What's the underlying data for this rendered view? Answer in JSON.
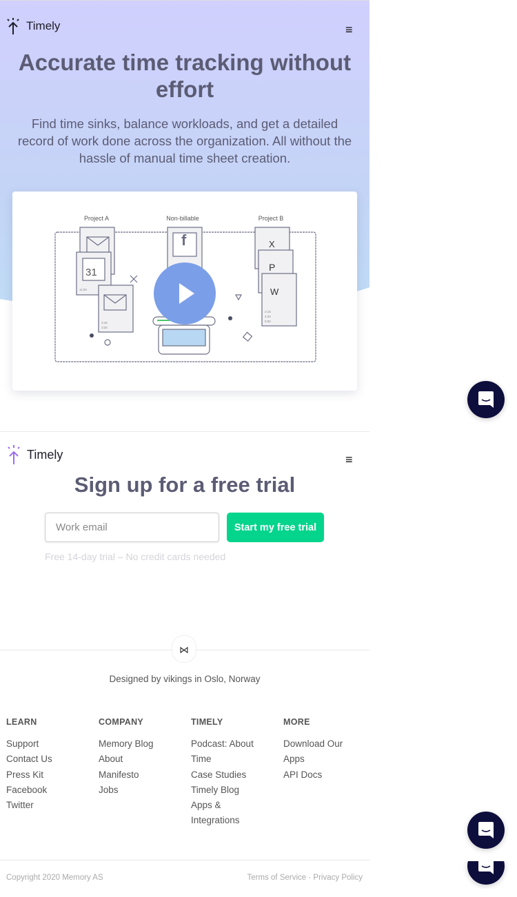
{
  "brand": "Timely",
  "hero": {
    "title": "Accurate time tracking without effort",
    "subtitle": "Find time sinks, balance workloads, and get a detailed record of work done across the organization. All without the hassle of manual time sheet creation.",
    "illustration": {
      "labels": [
        "Project A",
        "Non-billable",
        "Project B"
      ],
      "calendar_day": "31",
      "times": [
        "11:00",
        "2:45",
        "3:20",
        "2:15",
        "4:20",
        "5:00"
      ]
    }
  },
  "signup": {
    "title": "Sign up for a free trial",
    "email_placeholder": "Work email",
    "button": "Start my free trial",
    "note": "Free 14-day trial – No credit cards needed"
  },
  "footer": {
    "designed": "Designed by vikings in Oslo, Norway",
    "columns": [
      {
        "title": "LEARN",
        "links": [
          "Support",
          "Contact Us",
          "Press Kit",
          "Facebook",
          "Twitter"
        ]
      },
      {
        "title": "COMPANY",
        "links": [
          "Memory Blog",
          "About",
          "Manifesto",
          "Jobs"
        ]
      },
      {
        "title": "TIMELY",
        "links": [
          "Podcast: About Time",
          "Case Studies",
          "Timely Blog",
          "Apps & Integrations"
        ]
      },
      {
        "title": "MORE",
        "links": [
          "Download Our Apps",
          "API Docs"
        ]
      }
    ],
    "copyright": "Copyright 2020 Memory AS",
    "terms": "Terms of Service",
    "separator": "·",
    "privacy": "Privacy Policy"
  },
  "colors": {
    "accent": "#04d48c",
    "play": "#7b9ee8",
    "chat": "#0d0e3c",
    "logo_purple": "#9b6cf0"
  }
}
